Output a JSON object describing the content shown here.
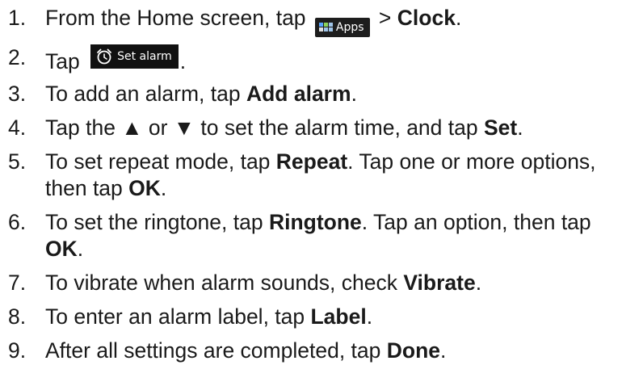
{
  "steps": [
    {
      "num": "1.",
      "t1": "From the Home screen,  tap ",
      "apps_label": "Apps",
      "t2": " > ",
      "b1": "Clock",
      "t3": "."
    },
    {
      "num": "2.",
      "t1": "Tap ",
      "alarm_label": "Set alarm",
      "t2": "."
    },
    {
      "num": "3.",
      "t1": "To add an alarm, tap ",
      "b1": "Add alarm",
      "t2": "."
    },
    {
      "num": "4.",
      "t1": "Tap the ▲ or ▼ to set the alarm time, and tap ",
      "b1": "Set",
      "t2": "."
    },
    {
      "num": "5.",
      "t1": "To set repeat mode, tap ",
      "b1": "Repeat",
      "t2": ". Tap one or more options, then tap ",
      "b2": "OK",
      "t3": "."
    },
    {
      "num": "6.",
      "t1": "To set the ringtone, tap ",
      "b1": "Ringtone",
      "t2": ". Tap an option, then tap ",
      "b2": "OK",
      "t3": "."
    },
    {
      "num": "7.",
      "t1": "To vibrate when alarm sounds, check ",
      "b1": "Vibrate",
      "t2": "."
    },
    {
      "num": "8.",
      "t1": "To enter an alarm label, tap ",
      "b1": "Label",
      "t2": "."
    },
    {
      "num": "9.",
      "t1": "After all settings are completed, tap ",
      "b1": "Done",
      "t2": "."
    }
  ],
  "icons": {
    "apps": "apps-grid-icon",
    "alarm": "alarm-clock-icon"
  }
}
